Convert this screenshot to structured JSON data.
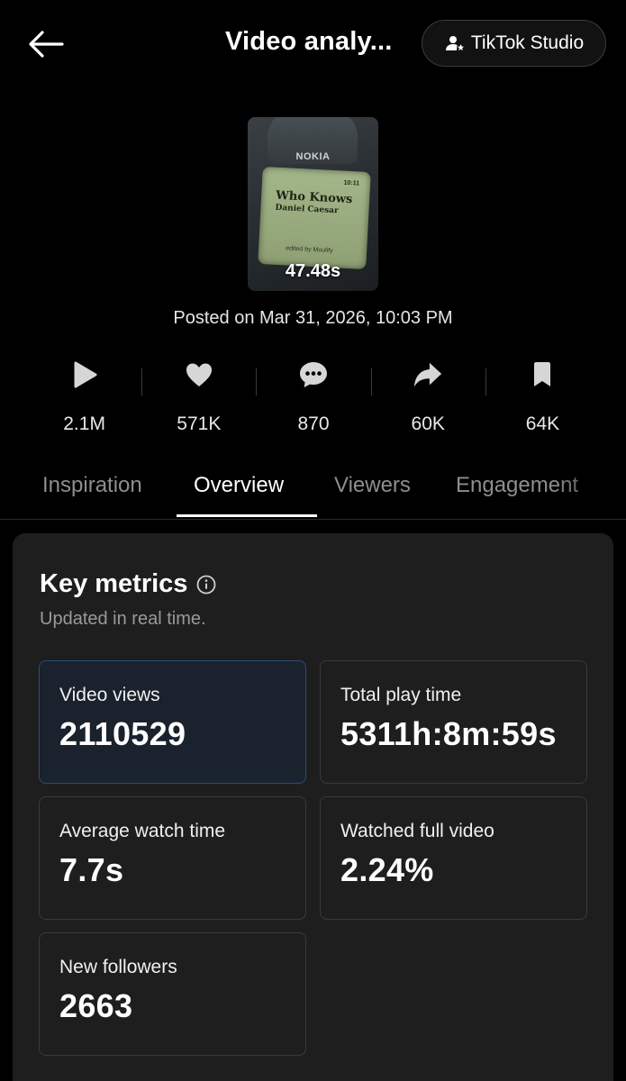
{
  "header": {
    "title": "Video analy...",
    "studio_button": "TikTok Studio"
  },
  "video": {
    "thumbnail_brand": "NOKIA",
    "thumbnail_song": "Who Knows",
    "thumbnail_artist": "Daniel Caesar",
    "thumbnail_time": "10:11",
    "thumbnail_credit": "edited by Moulify",
    "duration": "47.48s",
    "posted": "Posted on Mar 31, 2026, 10:03 PM"
  },
  "stats": [
    {
      "icon": "play-icon",
      "value": "2.1M"
    },
    {
      "icon": "heart-icon",
      "value": "571K"
    },
    {
      "icon": "comment-icon",
      "value": "870"
    },
    {
      "icon": "share-icon",
      "value": "60K"
    },
    {
      "icon": "bookmark-icon",
      "value": "64K"
    }
  ],
  "tabs": [
    "Inspiration",
    "Overview",
    "Viewers",
    "Engagement"
  ],
  "active_tab": "Overview",
  "key_metrics": {
    "title": "Key metrics",
    "subtitle": "Updated in real time.",
    "items": [
      {
        "label": "Video views",
        "value": "2110529"
      },
      {
        "label": "Total play time",
        "value": "5311h:8m:59s"
      },
      {
        "label": "Average watch time",
        "value": "7.7s"
      },
      {
        "label": "Watched full video",
        "value": "2.24%"
      },
      {
        "label": "New followers",
        "value": "2663"
      }
    ]
  },
  "colors": {
    "background": "#000000",
    "card": "#1e1e1e",
    "selected_border": "#2c4d7a",
    "muted_text": "#8e8e8e"
  }
}
